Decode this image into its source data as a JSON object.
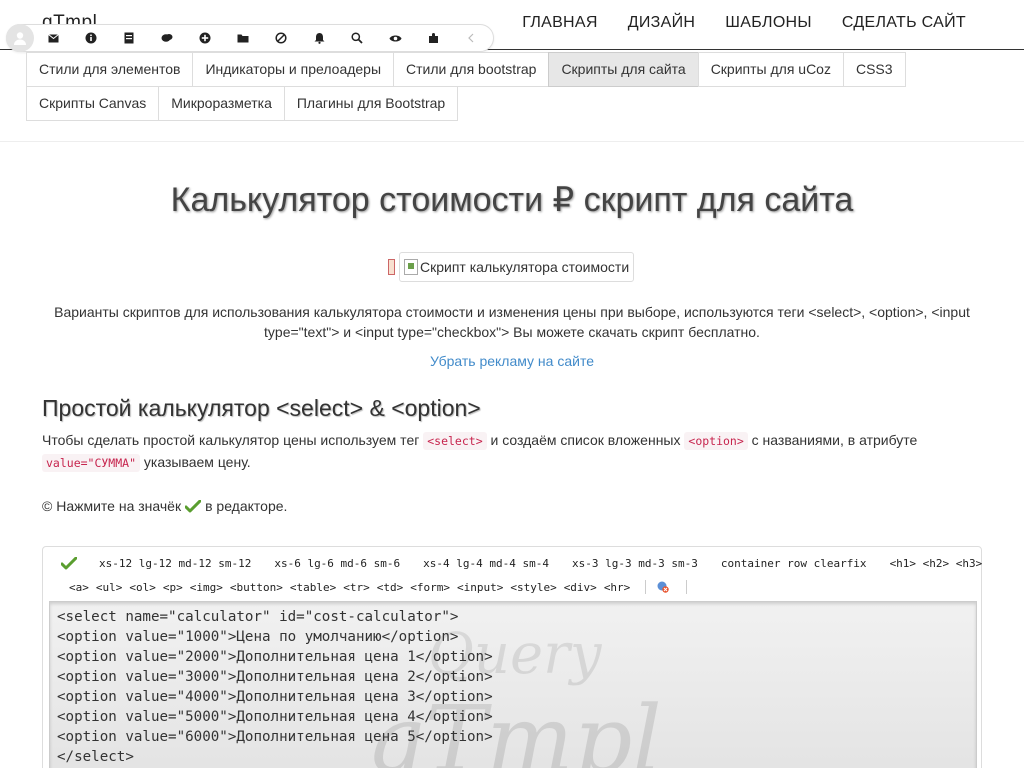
{
  "header": {
    "logo": "qTmpl",
    "menu": [
      "ГЛАВНАЯ",
      "ДИЗАЙН",
      "ШАБЛОНЫ",
      "СДЕЛАТЬ САЙТ"
    ]
  },
  "icon_bar": {
    "icons": [
      "mail-icon",
      "info-icon",
      "document-icon",
      "chat-icon",
      "plus-icon",
      "folder-icon",
      "ban-icon",
      "bell-icon",
      "search-icon",
      "eye-icon",
      "puzzle-icon",
      "chevron-left-icon"
    ]
  },
  "tabs": {
    "row1": [
      "Стили для элементов",
      "Индикаторы и прелоадеры",
      "Стили для bootstrap",
      "Скрипты для сайта",
      "Скрипты для uCoz",
      "CSS3"
    ],
    "row2": [
      "Скрипты Canvas",
      "Микроразметка",
      "Плагины для Bootstrap"
    ],
    "active": "Скрипты для сайта"
  },
  "main": {
    "title": "Калькулятор стоимости ₽ скрипт для сайта",
    "image_alt": "Скрипт калькулятора стоимости",
    "intro": "Варианты скриптов для использования калькулятора стоимости и изменения цены при выборе, используются теги <select>, <option>, <input type=\"text\"> и <input type=\"checkbox\"> Вы можете скачать скрипт бесплатно.",
    "ad_link": "Убрать рекламу на сайте",
    "section_title": "Простой калькулятор <select> & <option>",
    "desc_part1": "Чтобы сделать простой калькулятор цены используем тег",
    "desc_code1": "<select>",
    "desc_part2": "и создаём список вложенных",
    "desc_code2": "<option>",
    "desc_part3": "с названиями, в атрибуте",
    "desc_code3": "value=\"СУММА\"",
    "desc_part4": "указываем цену.",
    "note_part1": "© Нажмите на значёк",
    "note_part2": "в редакторе."
  },
  "editor": {
    "toolbar_row1": [
      "xs-12 lg-12 md-12 sm-12",
      "xs-6 lg-6 md-6 sm-6",
      "xs-4 lg-4 md-4 sm-4",
      "xs-3 lg-3 md-3 sm-3",
      "container row clearfix",
      "<h1> <h2> <h3>"
    ],
    "toolbar_row2": [
      "<a>",
      "<ul>",
      "<ol>",
      "<p>",
      "<img>",
      "<button>",
      "<table>",
      "<tr>",
      "<td>",
      "<form>",
      "<input>",
      "<style>",
      "<div>",
      "<hr>"
    ],
    "watermark_top": "Query",
    "watermark_bottom": "qTmpl",
    "code": [
      "<select name=\"calculator\" id=\"cost-calculator\">",
      "<option value=\"1000\">Цена по умолчанию</option>",
      "<option value=\"2000\">Дополнительная цена 1</option>",
      "<option value=\"3000\">Дополнительная цена 2</option>",
      "<option value=\"4000\">Дополнительная цена 3</option>",
      "<option value=\"5000\">Дополнительная цена 4</option>",
      "<option value=\"6000\">Дополнительная цена 5</option>",
      "</select>"
    ]
  },
  "colors": {
    "link": "#428bca",
    "code_text": "#c7254e",
    "check_green": "#5a9e2f"
  }
}
